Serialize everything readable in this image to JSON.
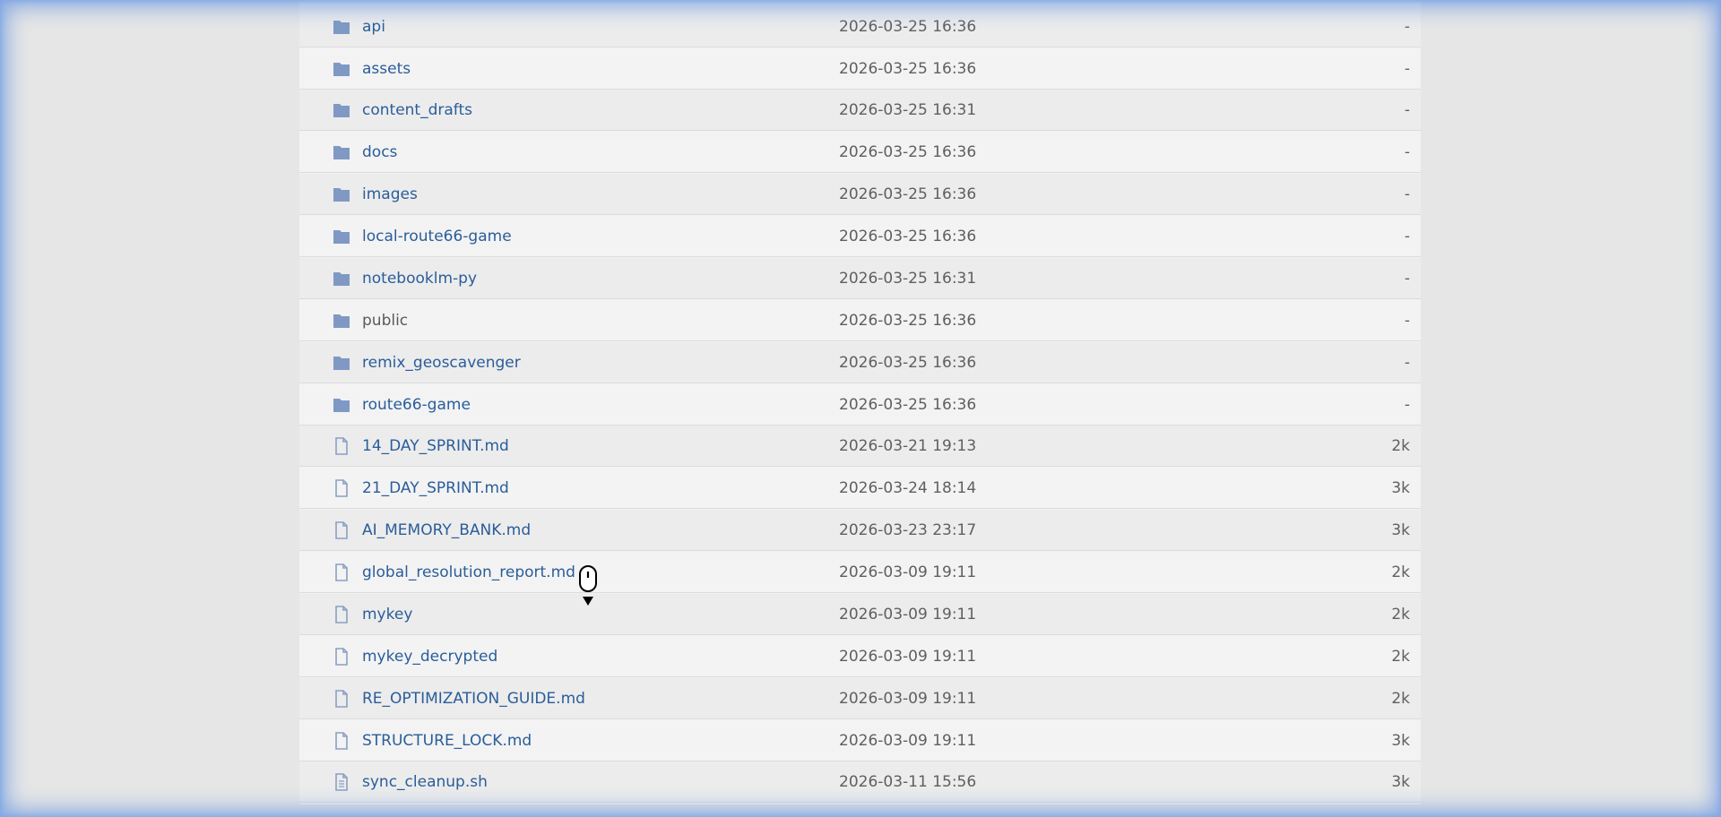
{
  "listing": {
    "rows": [
      {
        "name": "api",
        "date": "2026-03-25 16:36",
        "size": "-",
        "type": "folder-icon"
      },
      {
        "name": "assets",
        "date": "2026-03-25 16:36",
        "size": "-",
        "type": "folder-icon"
      },
      {
        "name": "content_drafts",
        "date": "2026-03-25 16:31",
        "size": "-",
        "type": "folder-icon"
      },
      {
        "name": "docs",
        "date": "2026-03-25 16:36",
        "size": "-",
        "type": "folder-icon"
      },
      {
        "name": "images",
        "date": "2026-03-25 16:36",
        "size": "-",
        "type": "folder-icon"
      },
      {
        "name": "local-route66-game",
        "date": "2026-03-25 16:36",
        "size": "-",
        "type": "folder-icon"
      },
      {
        "name": "notebooklm-py",
        "date": "2026-03-25 16:31",
        "size": "-",
        "type": "folder-icon"
      },
      {
        "name": "public",
        "date": "2026-03-25 16:36",
        "size": "-",
        "type": "folder-icon"
      },
      {
        "name": "remix_geoscavenger",
        "date": "2026-03-25 16:36",
        "size": "-",
        "type": "folder-icon"
      },
      {
        "name": "route66-game",
        "date": "2026-03-25 16:36",
        "size": "-",
        "type": "folder-icon"
      },
      {
        "name": "14_DAY_SPRINT.md",
        "date": "2026-03-21 19:13",
        "size": "2k",
        "type": "file-icon"
      },
      {
        "name": "21_DAY_SPRINT.md",
        "date": "2026-03-24 18:14",
        "size": "3k",
        "type": "file-icon"
      },
      {
        "name": "AI_MEMORY_BANK.md",
        "date": "2026-03-23 23:17",
        "size": "3k",
        "type": "file-icon"
      },
      {
        "name": "global_resolution_report.md",
        "date": "2026-03-09 19:11",
        "size": "2k",
        "type": "file-icon"
      },
      {
        "name": "mykey",
        "date": "2026-03-09 19:11",
        "size": "2k",
        "type": "file-icon"
      },
      {
        "name": "mykey_decrypted",
        "date": "2026-03-09 19:11",
        "size": "2k",
        "type": "file-icon"
      },
      {
        "name": "RE_OPTIMIZATION_GUIDE.md",
        "date": "2026-03-09 19:11",
        "size": "2k",
        "type": "file-icon"
      },
      {
        "name": "STRUCTURE_LOCK.md",
        "date": "2026-03-09 19:11",
        "size": "3k",
        "type": "file-icon"
      },
      {
        "name": "sync_cleanup.sh",
        "date": "2026-03-11 15:56",
        "size": "3k",
        "type": "script-file-icon"
      }
    ]
  },
  "colors": {
    "link": "#2a5d9a",
    "folder_icon": "#7f99c4",
    "file_icon": "#8aa0c4",
    "row_a": "#f3f3f3",
    "row_b": "#ececec"
  },
  "cursor": {
    "icon": "scroll-mouse-cursor-icon"
  }
}
